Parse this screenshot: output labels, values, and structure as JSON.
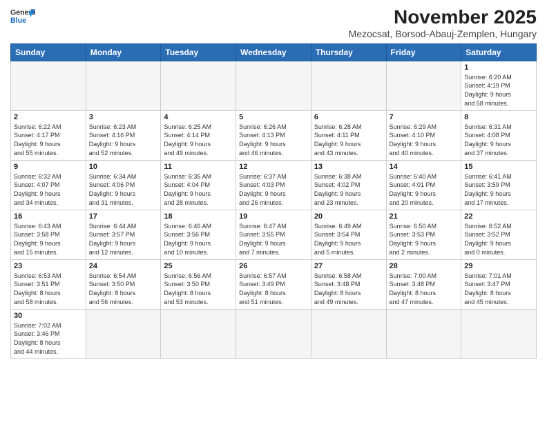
{
  "header": {
    "logo_general": "General",
    "logo_blue": "Blue",
    "title": "November 2025",
    "subtitle": "Mezocsat, Borsod-Abauj-Zemplen, Hungary"
  },
  "weekdays": [
    "Sunday",
    "Monday",
    "Tuesday",
    "Wednesday",
    "Thursday",
    "Friday",
    "Saturday"
  ],
  "weeks": [
    [
      {
        "day": "",
        "info": ""
      },
      {
        "day": "",
        "info": ""
      },
      {
        "day": "",
        "info": ""
      },
      {
        "day": "",
        "info": ""
      },
      {
        "day": "",
        "info": ""
      },
      {
        "day": "",
        "info": ""
      },
      {
        "day": "1",
        "info": "Sunrise: 6:20 AM\nSunset: 4:19 PM\nDaylight: 9 hours\nand 58 minutes."
      }
    ],
    [
      {
        "day": "2",
        "info": "Sunrise: 6:22 AM\nSunset: 4:17 PM\nDaylight: 9 hours\nand 55 minutes."
      },
      {
        "day": "3",
        "info": "Sunrise: 6:23 AM\nSunset: 4:16 PM\nDaylight: 9 hours\nand 52 minutes."
      },
      {
        "day": "4",
        "info": "Sunrise: 6:25 AM\nSunset: 4:14 PM\nDaylight: 9 hours\nand 49 minutes."
      },
      {
        "day": "5",
        "info": "Sunrise: 6:26 AM\nSunset: 4:13 PM\nDaylight: 9 hours\nand 46 minutes."
      },
      {
        "day": "6",
        "info": "Sunrise: 6:28 AM\nSunset: 4:11 PM\nDaylight: 9 hours\nand 43 minutes."
      },
      {
        "day": "7",
        "info": "Sunrise: 6:29 AM\nSunset: 4:10 PM\nDaylight: 9 hours\nand 40 minutes."
      },
      {
        "day": "8",
        "info": "Sunrise: 6:31 AM\nSunset: 4:08 PM\nDaylight: 9 hours\nand 37 minutes."
      }
    ],
    [
      {
        "day": "9",
        "info": "Sunrise: 6:32 AM\nSunset: 4:07 PM\nDaylight: 9 hours\nand 34 minutes."
      },
      {
        "day": "10",
        "info": "Sunrise: 6:34 AM\nSunset: 4:06 PM\nDaylight: 9 hours\nand 31 minutes."
      },
      {
        "day": "11",
        "info": "Sunrise: 6:35 AM\nSunset: 4:04 PM\nDaylight: 9 hours\nand 28 minutes."
      },
      {
        "day": "12",
        "info": "Sunrise: 6:37 AM\nSunset: 4:03 PM\nDaylight: 9 hours\nand 26 minutes."
      },
      {
        "day": "13",
        "info": "Sunrise: 6:38 AM\nSunset: 4:02 PM\nDaylight: 9 hours\nand 23 minutes."
      },
      {
        "day": "14",
        "info": "Sunrise: 6:40 AM\nSunset: 4:01 PM\nDaylight: 9 hours\nand 20 minutes."
      },
      {
        "day": "15",
        "info": "Sunrise: 6:41 AM\nSunset: 3:59 PM\nDaylight: 9 hours\nand 17 minutes."
      }
    ],
    [
      {
        "day": "16",
        "info": "Sunrise: 6:43 AM\nSunset: 3:58 PM\nDaylight: 9 hours\nand 15 minutes."
      },
      {
        "day": "17",
        "info": "Sunrise: 6:44 AM\nSunset: 3:57 PM\nDaylight: 9 hours\nand 12 minutes."
      },
      {
        "day": "18",
        "info": "Sunrise: 6:46 AM\nSunset: 3:56 PM\nDaylight: 9 hours\nand 10 minutes."
      },
      {
        "day": "19",
        "info": "Sunrise: 6:47 AM\nSunset: 3:55 PM\nDaylight: 9 hours\nand 7 minutes."
      },
      {
        "day": "20",
        "info": "Sunrise: 6:49 AM\nSunset: 3:54 PM\nDaylight: 9 hours\nand 5 minutes."
      },
      {
        "day": "21",
        "info": "Sunrise: 6:50 AM\nSunset: 3:53 PM\nDaylight: 9 hours\nand 2 minutes."
      },
      {
        "day": "22",
        "info": "Sunrise: 6:52 AM\nSunset: 3:52 PM\nDaylight: 9 hours\nand 0 minutes."
      }
    ],
    [
      {
        "day": "23",
        "info": "Sunrise: 6:53 AM\nSunset: 3:51 PM\nDaylight: 8 hours\nand 58 minutes."
      },
      {
        "day": "24",
        "info": "Sunrise: 6:54 AM\nSunset: 3:50 PM\nDaylight: 8 hours\nand 56 minutes."
      },
      {
        "day": "25",
        "info": "Sunrise: 6:56 AM\nSunset: 3:50 PM\nDaylight: 8 hours\nand 53 minutes."
      },
      {
        "day": "26",
        "info": "Sunrise: 6:57 AM\nSunset: 3:49 PM\nDaylight: 8 hours\nand 51 minutes."
      },
      {
        "day": "27",
        "info": "Sunrise: 6:58 AM\nSunset: 3:48 PM\nDaylight: 8 hours\nand 49 minutes."
      },
      {
        "day": "28",
        "info": "Sunrise: 7:00 AM\nSunset: 3:48 PM\nDaylight: 8 hours\nand 47 minutes."
      },
      {
        "day": "29",
        "info": "Sunrise: 7:01 AM\nSunset: 3:47 PM\nDaylight: 8 hours\nand 45 minutes."
      }
    ],
    [
      {
        "day": "30",
        "info": "Sunrise: 7:02 AM\nSunset: 3:46 PM\nDaylight: 8 hours\nand 44 minutes."
      },
      {
        "day": "",
        "info": ""
      },
      {
        "day": "",
        "info": ""
      },
      {
        "day": "",
        "info": ""
      },
      {
        "day": "",
        "info": ""
      },
      {
        "day": "",
        "info": ""
      },
      {
        "day": "",
        "info": ""
      }
    ]
  ]
}
